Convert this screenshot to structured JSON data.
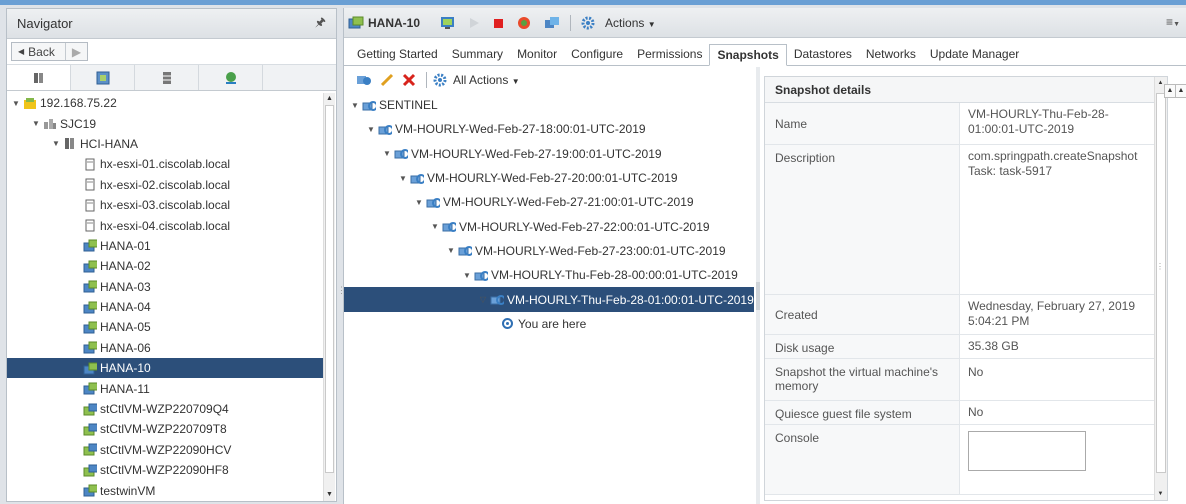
{
  "navigator": {
    "title": "Navigator",
    "back_label": "Back",
    "tree": [
      {
        "label": "192.168.75.22",
        "level": 0,
        "icon": "vcenter",
        "expanded": true
      },
      {
        "label": "SJC19",
        "level": 1,
        "icon": "datacenter",
        "expanded": true
      },
      {
        "label": "HCI-HANA",
        "level": 2,
        "icon": "cluster",
        "expanded": true
      },
      {
        "label": "hx-esxi-01.ciscolab.local",
        "level": 3,
        "icon": "host"
      },
      {
        "label": "hx-esxi-02.ciscolab.local",
        "level": 3,
        "icon": "host"
      },
      {
        "label": "hx-esxi-03.ciscolab.local",
        "level": 3,
        "icon": "host"
      },
      {
        "label": "hx-esxi-04.ciscolab.local",
        "level": 3,
        "icon": "host"
      },
      {
        "label": "HANA-01",
        "level": 3,
        "icon": "vm"
      },
      {
        "label": "HANA-02",
        "level": 3,
        "icon": "vm"
      },
      {
        "label": "HANA-03",
        "level": 3,
        "icon": "vm"
      },
      {
        "label": "HANA-04",
        "level": 3,
        "icon": "vm"
      },
      {
        "label": "HANA-05",
        "level": 3,
        "icon": "vm"
      },
      {
        "label": "HANA-06",
        "level": 3,
        "icon": "vm"
      },
      {
        "label": "HANA-10",
        "level": 3,
        "icon": "vm",
        "selected": true
      },
      {
        "label": "HANA-11",
        "level": 3,
        "icon": "vm"
      },
      {
        "label": "stCtlVM-WZP220709Q4",
        "level": 3,
        "icon": "ctlvm"
      },
      {
        "label": "stCtlVM-WZP220709T8",
        "level": 3,
        "icon": "ctlvm"
      },
      {
        "label": "stCtlVM-WZP22090HCV",
        "level": 3,
        "icon": "ctlvm"
      },
      {
        "label": "stCtlVM-WZP22090HF8",
        "level": 3,
        "icon": "ctlvm"
      },
      {
        "label": "testwinVM",
        "level": 3,
        "icon": "vm"
      }
    ]
  },
  "header": {
    "vm_name": "HANA-10",
    "actions_label": "Actions"
  },
  "tabs": [
    {
      "label": "Getting Started"
    },
    {
      "label": "Summary"
    },
    {
      "label": "Monitor"
    },
    {
      "label": "Configure"
    },
    {
      "label": "Permissions"
    },
    {
      "label": "Snapshots",
      "active": true
    },
    {
      "label": "Datastores"
    },
    {
      "label": "Networks"
    },
    {
      "label": "Update Manager"
    }
  ],
  "snapshots": {
    "all_actions_label": "All Actions",
    "tree": [
      {
        "label": "SENTINEL",
        "level": 0
      },
      {
        "label": "VM-HOURLY-Wed-Feb-27-18:00:01-UTC-2019",
        "level": 1
      },
      {
        "label": "VM-HOURLY-Wed-Feb-27-19:00:01-UTC-2019",
        "level": 2
      },
      {
        "label": "VM-HOURLY-Wed-Feb-27-20:00:01-UTC-2019",
        "level": 3
      },
      {
        "label": "VM-HOURLY-Wed-Feb-27-21:00:01-UTC-2019",
        "level": 4
      },
      {
        "label": "VM-HOURLY-Wed-Feb-27-22:00:01-UTC-2019",
        "level": 5
      },
      {
        "label": "VM-HOURLY-Wed-Feb-27-23:00:01-UTC-2019",
        "level": 6
      },
      {
        "label": "VM-HOURLY-Thu-Feb-28-00:00:01-UTC-2019",
        "level": 7
      },
      {
        "label": "VM-HOURLY-Thu-Feb-28-01:00:01-UTC-2019",
        "level": 8,
        "selected": true
      },
      {
        "label": "You are here",
        "level": 9,
        "here": true
      }
    ]
  },
  "details": {
    "title": "Snapshot details",
    "rows": [
      {
        "key": "Name",
        "value": "VM-HOURLY-Thu-Feb-28-01:00:01-UTC-2019"
      },
      {
        "key": "Description",
        "value": "com.springpath.createSnapshot Task: task-5917"
      },
      {
        "key": "Created",
        "value": "Wednesday, February 27, 2019 5:04:21 PM"
      },
      {
        "key": "Disk usage",
        "value": "35.38 GB"
      },
      {
        "key": "Snapshot the virtual machine's memory",
        "value": "No"
      },
      {
        "key": "Quiesce guest file system",
        "value": "No"
      },
      {
        "key": "Console",
        "value": ""
      }
    ]
  },
  "colors": {
    "selection": "#2c4f7a",
    "accent": "#6a9fd4"
  }
}
